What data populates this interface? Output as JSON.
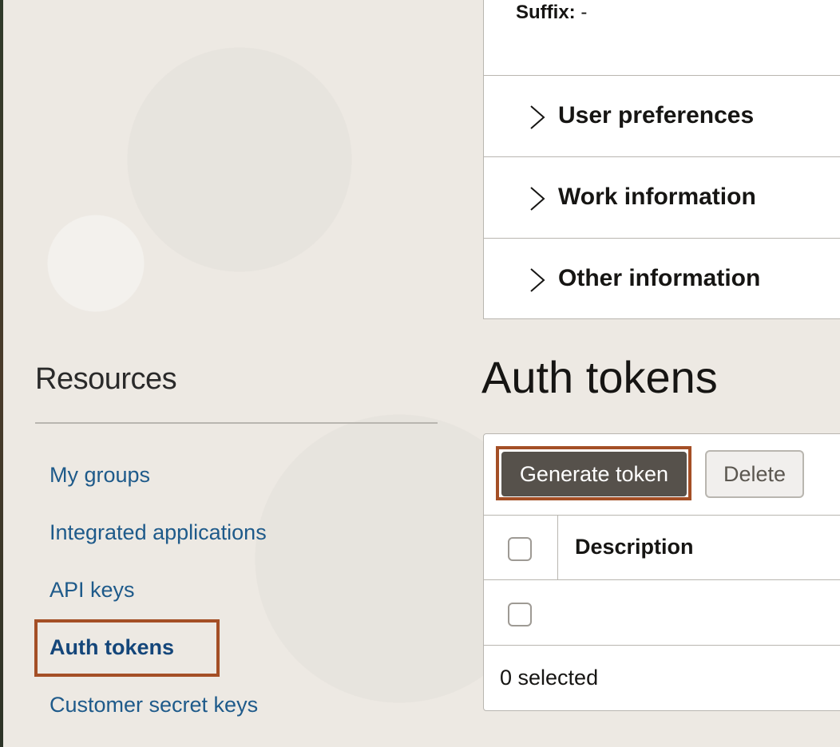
{
  "user_info": {
    "suffix_label": "Suffix:",
    "suffix_value": "-",
    "sections": [
      {
        "label": "User preferences"
      },
      {
        "label": "Work information"
      },
      {
        "label": "Other information"
      }
    ]
  },
  "resources": {
    "title": "Resources",
    "links": [
      {
        "label": "My groups"
      },
      {
        "label": "Integrated applications"
      },
      {
        "label": "API keys"
      },
      {
        "label": "Auth tokens",
        "active": true
      },
      {
        "label": "Customer secret keys"
      }
    ]
  },
  "auth_tokens": {
    "title": "Auth tokens",
    "generate_label": "Generate token",
    "delete_label": "Delete",
    "column_description": "Description",
    "selected_text": "0 selected"
  },
  "colors": {
    "link": "#1e5a8a",
    "highlight": "#a44f26",
    "primary_button": "#56514b"
  }
}
